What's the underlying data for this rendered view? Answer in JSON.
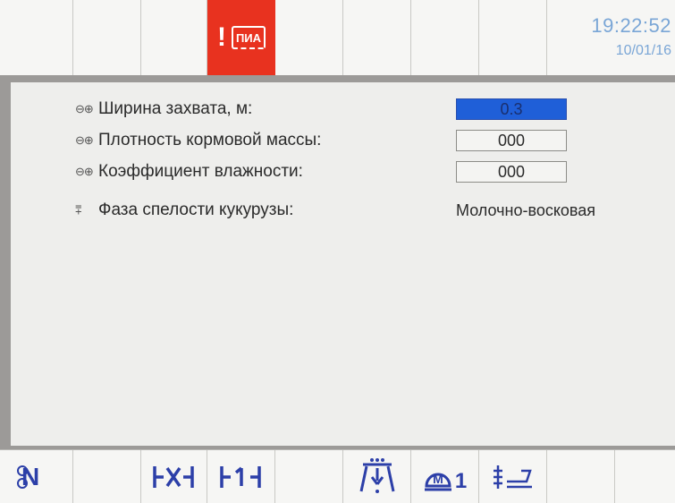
{
  "header": {
    "alarm": {
      "mark": "!",
      "badge": "ПИА"
    },
    "time": "19:22:52",
    "date": "10/01/16"
  },
  "settings": [
    {
      "icon": "⊖⊕",
      "label": "Ширина захвата, м:",
      "value": "0.3",
      "active": true
    },
    {
      "icon": "⊖⊕",
      "label": "Плотность кормовой массы:",
      "value": "000",
      "active": false
    },
    {
      "icon": "⊖⊕",
      "label": "Коэффициент влажности:",
      "value": "000",
      "active": false
    },
    {
      "icon": "⩱",
      "label": "Фаза спелости кукурузы:",
      "value": "Молочно-восковая"
    }
  ],
  "footer": {
    "neutral_label": "N",
    "motor_label": "1"
  },
  "colors": {
    "alarm": "#e8321f",
    "active_field": "#1f5fd8",
    "clock": "#7aa6d6",
    "icon_blue": "#2c3fa8"
  }
}
